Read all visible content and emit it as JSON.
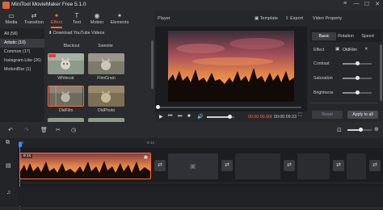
{
  "app": {
    "title": "MiniTool MovieMaker Free 5.1.0"
  },
  "window_controls": {
    "minimize": "—",
    "maximize": "☐",
    "close": "✕",
    "menu": "≡"
  },
  "toolbar": {
    "items": [
      {
        "label": "Media",
        "icon": "folder-icon",
        "glyph": "▭"
      },
      {
        "label": "Transition",
        "icon": "transition-icon",
        "glyph": "⇄"
      },
      {
        "label": "Effect",
        "icon": "effect-icon",
        "glyph": "✦"
      },
      {
        "label": "Text",
        "icon": "text-icon",
        "glyph": "T"
      },
      {
        "label": "Motion",
        "icon": "motion-icon",
        "glyph": "◉"
      },
      {
        "label": "Elements",
        "icon": "elements-icon",
        "glyph": "✶"
      }
    ],
    "active": "Effect",
    "accent": "#ff6b3d"
  },
  "categories": [
    {
      "label": "All (58)",
      "active": false
    },
    {
      "label": "Artistic (10)",
      "active": true
    },
    {
      "label": "Common (17)",
      "active": false
    },
    {
      "label": "Instagram-Like (26)",
      "active": false
    },
    {
      "label": "MotionBlur (1)",
      "active": false
    }
  ],
  "effects": {
    "download_link": "Download YouTube Videos",
    "tiles": [
      {
        "label": "Blackout"
      },
      {
        "label": "Sweetie"
      },
      {
        "label": "Whitecat"
      },
      {
        "label": "FilmGrain"
      },
      {
        "label": "OldFilm"
      },
      {
        "label": "OldPhoto"
      }
    ]
  },
  "player": {
    "label": "Player",
    "template_btn": "Template",
    "export_btn": "Export",
    "time_current": "00:00:00.00",
    "time_separator": "/",
    "time_total": "00:00:09.03",
    "progress_fraction": 0.0,
    "volume_fraction": 0.85
  },
  "properties": {
    "title": "Video Property",
    "tabs": [
      "Basic",
      "Rotation",
      "Speed"
    ],
    "active_tab": "Basic",
    "effect_label": "Effect",
    "effect_value": "OldFilm",
    "sliders": [
      {
        "label": "Contrast",
        "value": 0.5
      },
      {
        "label": "Saturation",
        "value": 0.5
      },
      {
        "label": "Brightness",
        "value": 0.5
      }
    ],
    "reset_btn": "Reset",
    "apply_all_btn": "Apply to all"
  },
  "timeline": {
    "ruler_marks": [
      "0s",
      "9.1s"
    ],
    "clip_label": "9.1s",
    "zoom_fraction": 0.55
  }
}
